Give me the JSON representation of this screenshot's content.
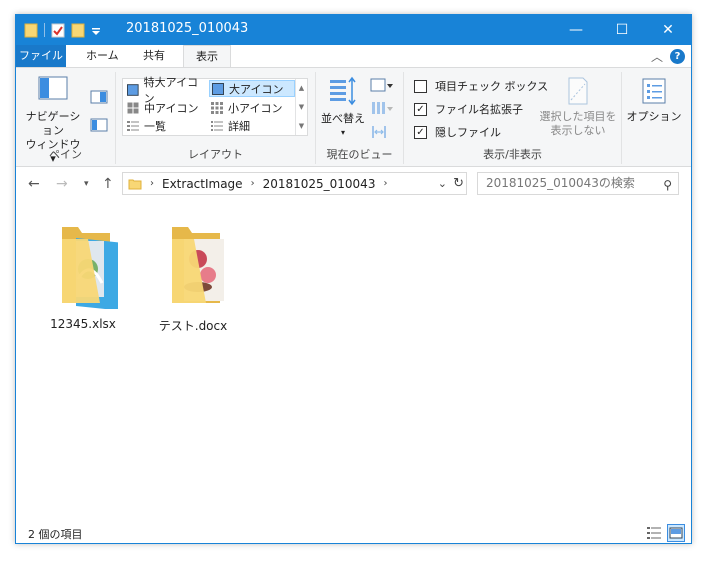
{
  "window": {
    "title": "20181025_010043",
    "controls": {
      "minimize": "—",
      "maximize": "☐",
      "close": "✕"
    }
  },
  "tabs": [
    {
      "label": "ファイル"
    },
    {
      "label": "ホーム"
    },
    {
      "label": "共有"
    },
    {
      "label": "表示"
    }
  ],
  "ribbon": {
    "pane": {
      "nav_pane_line1": "ナビゲーション",
      "nav_pane_line2": "ウィンドウ",
      "group_label": "ペイン"
    },
    "layout": {
      "items": [
        {
          "label": "特大アイコン"
        },
        {
          "label": "大アイコン"
        },
        {
          "label": "中アイコン"
        },
        {
          "label": "小アイコン"
        },
        {
          "label": "一覧"
        },
        {
          "label": "詳細"
        }
      ],
      "selected": "大アイコン",
      "group_label": "レイアウト"
    },
    "current_view": {
      "sort_label": "並べ替え",
      "group_label": "現在のビュー"
    },
    "show_hide": {
      "checkboxes": [
        {
          "label": "項目チェック ボックス",
          "checked": false
        },
        {
          "label": "ファイル名拡張子",
          "checked": true
        },
        {
          "label": "隠しファイル",
          "checked": true
        }
      ],
      "hide_selected_line1": "選択した項目を",
      "hide_selected_line2": "表示しない",
      "group_label": "表示/非表示"
    },
    "options": {
      "label": "オプション"
    }
  },
  "address": {
    "path": [
      "ExtractImage",
      "20181025_010043"
    ],
    "search_placeholder": "20181025_010043の検索"
  },
  "files": [
    {
      "name": "12345.xlsx"
    },
    {
      "name": "テスト.docx"
    }
  ],
  "status": {
    "item_count": "2 個の項目"
  },
  "colors": {
    "accent": "#1883d7",
    "file_tab": "#1979ca",
    "selection": "#cce8ff"
  }
}
